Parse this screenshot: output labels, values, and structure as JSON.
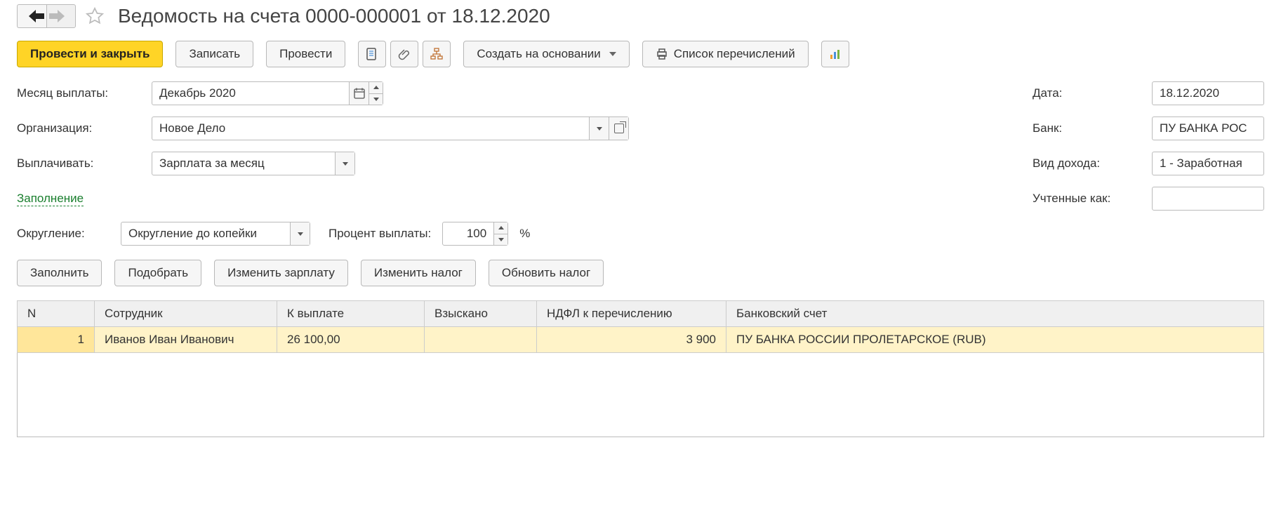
{
  "title": "Ведомость на счета 0000-000001 от 18.12.2020",
  "toolbar": {
    "post_close": "Провести и закрыть",
    "save": "Записать",
    "post": "Провести",
    "create_based": "Создать на основании",
    "transfer_list": "Список перечислений"
  },
  "form": {
    "month_label": "Месяц выплаты:",
    "month_value": "Декабрь 2020",
    "date_label": "Дата:",
    "date_value": "18.12.2020",
    "org_label": "Организация:",
    "org_value": "Новое Дело",
    "bank_label": "Банк:",
    "bank_value": "ПУ БАНКА РОС",
    "pay_label": "Выплачивать:",
    "pay_value": "Зарплата за месяц",
    "income_type_label": "Вид дохода:",
    "income_type_value": "1 - Заработная",
    "recorded_as_label": "Учтенные как:",
    "recorded_as_value": "",
    "fill_link": "Заполнение",
    "rounding_label": "Округление:",
    "rounding_value": "Округление до копейки",
    "pay_percent_label": "Процент выплаты:",
    "pay_percent_value": "100",
    "percent_sign": "%"
  },
  "buttons": {
    "fill": "Заполнить",
    "pick": "Подобрать",
    "edit_salary": "Изменить зарплату",
    "edit_tax": "Изменить налог",
    "refresh_tax": "Обновить налог"
  },
  "table": {
    "headers": {
      "n": "N",
      "employee": "Сотрудник",
      "to_pay": "К выплате",
      "withheld": "Взыскано",
      "tax": "НДФЛ к перечислению",
      "bank_account": "Банковский счет"
    },
    "rows": [
      {
        "n": "1",
        "employee": "Иванов Иван Иванович",
        "to_pay": "26 100,00",
        "withheld": "",
        "tax": "3 900",
        "bank_account": "ПУ БАНКА РОССИИ ПРОЛЕТАРСКОЕ (RUB)"
      }
    ]
  }
}
